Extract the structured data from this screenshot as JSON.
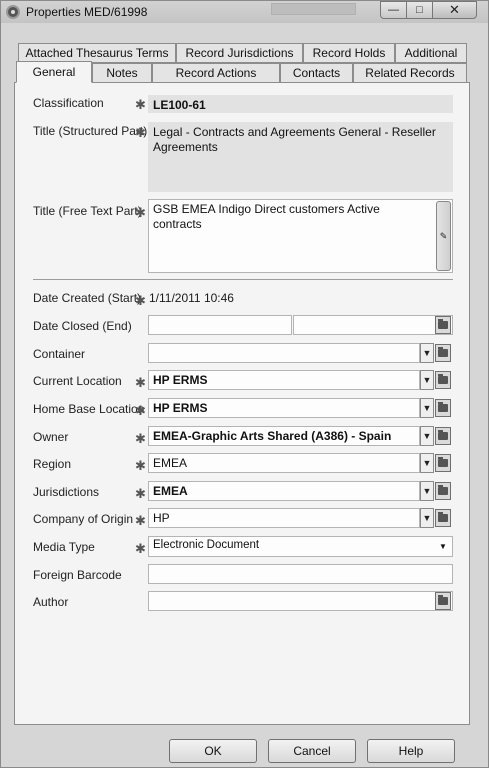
{
  "window": {
    "title": "Properties MED/61998"
  },
  "tabs_back": [
    "Attached Thesaurus Terms",
    "Record Jurisdictions",
    "Record Holds",
    "Additional"
  ],
  "tabs_front": [
    "General",
    "Notes",
    "Record Actions",
    "Contacts",
    "Related Records"
  ],
  "fields": {
    "classification": {
      "label": "Classification",
      "value": "LE100-61"
    },
    "title_structured": {
      "label": "Title (Structured Part)",
      "value": "Legal - Contracts and Agreements General - Reseller Agreements"
    },
    "title_free": {
      "label": "Title (Free Text Part)",
      "value": "GSB EMEA  Indigo  Direct customers Active contracts"
    },
    "date_created": {
      "label": "Date Created (Start)",
      "value": "1/11/2011 10:46"
    },
    "date_closed": {
      "label": "Date Closed (End)",
      "value": "",
      "value2": ""
    },
    "container": {
      "label": "Container",
      "value": ""
    },
    "current_location": {
      "label": "Current Location",
      "value": "HP ERMS"
    },
    "home_base_location": {
      "label": "Home Base Location",
      "value": "HP ERMS"
    },
    "owner": {
      "label": "Owner",
      "value": "EMEA-Graphic Arts Shared (A386) - Spain"
    },
    "region": {
      "label": "Region",
      "value": "EMEA"
    },
    "jurisdictions": {
      "label": "Jurisdictions",
      "value": "EMEA"
    },
    "company_of_origin": {
      "label": "Company of Origin",
      "value": "HP"
    },
    "media_type": {
      "label": "Media Type",
      "value": "Electronic Document"
    },
    "foreign_barcode": {
      "label": "Foreign Barcode",
      "value": ""
    },
    "author": {
      "label": "Author",
      "value": ""
    }
  },
  "buttons": {
    "ok": "OK",
    "cancel": "Cancel",
    "help": "Help"
  },
  "icons": {
    "required": "asterisk-icon",
    "dropdown": "chevron-down-icon",
    "browse": "folder-icon",
    "calendar": "calendar-icon",
    "spell": "spellcheck-icon"
  }
}
